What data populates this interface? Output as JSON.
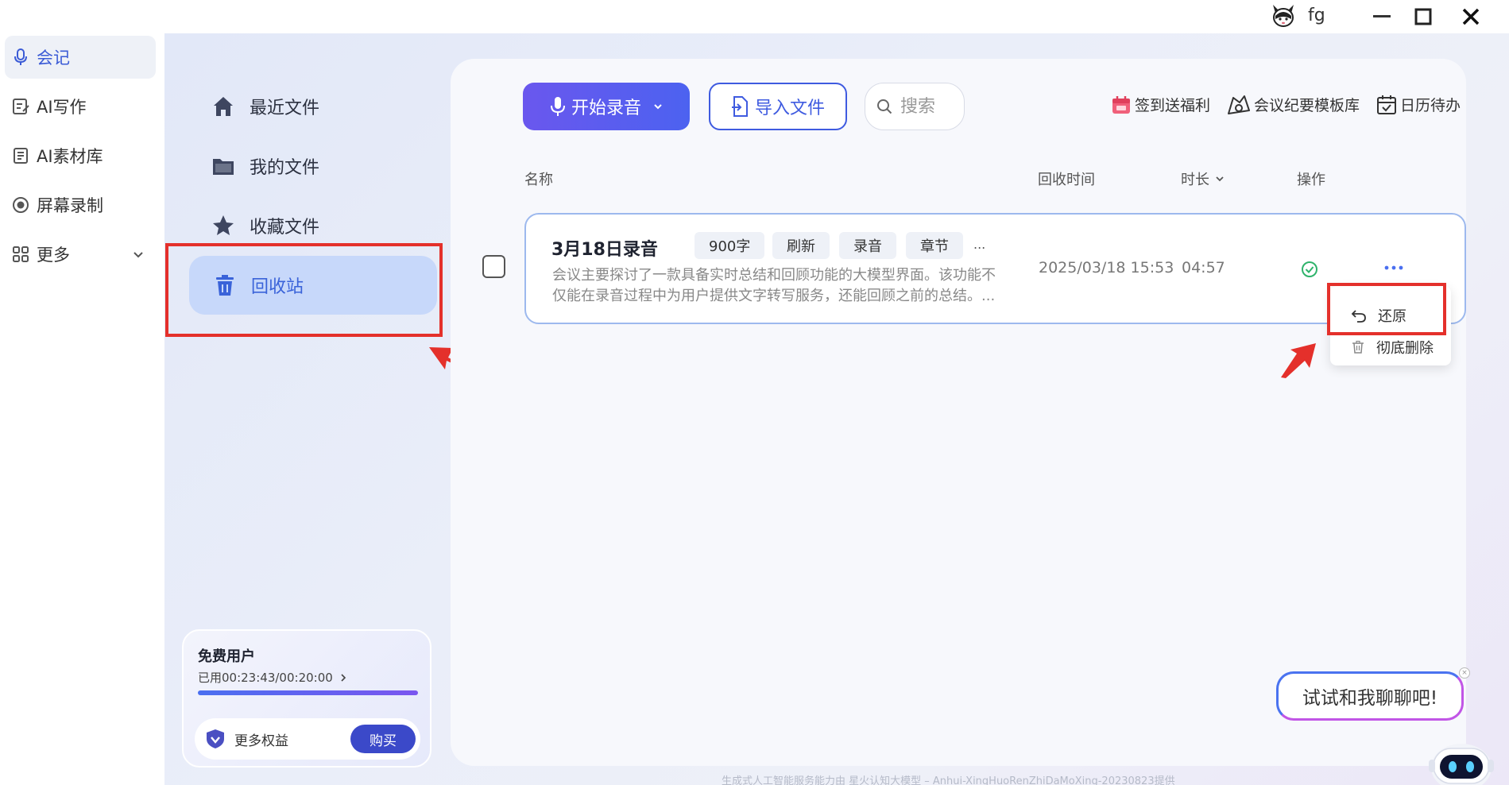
{
  "titlebar": {
    "username": "fg",
    "icons": [
      "avatar-icon",
      "minimize-icon",
      "maximize-icon",
      "close-icon"
    ]
  },
  "leftnav": {
    "items": [
      {
        "label": "会记",
        "icon": "microphone-icon",
        "active": true
      },
      {
        "label": "AI写作",
        "icon": "edit-icon"
      },
      {
        "label": "AI素材库",
        "icon": "document-icon"
      },
      {
        "label": "屏幕录制",
        "icon": "record-icon"
      },
      {
        "label": "更多",
        "icon": "grid-icon"
      }
    ]
  },
  "subnav": {
    "items": [
      {
        "label": "最近文件",
        "icon": "home-icon"
      },
      {
        "label": "我的文件",
        "icon": "folder-icon"
      },
      {
        "label": "收藏文件",
        "icon": "star-icon"
      },
      {
        "label": "回收站",
        "icon": "trash-icon",
        "active": true
      }
    ]
  },
  "user_card": {
    "title": "免费用户",
    "usage": "已用00:23:43/00:20:00",
    "usage_fraction": 1.0,
    "more_label": "更多权益",
    "buy_label": "购买"
  },
  "toolbar": {
    "record_label": "开始录音",
    "import_label": "导入文件",
    "search_placeholder": "搜索",
    "links": [
      {
        "label": "签到送福利",
        "icon": "calendar-gift-icon"
      },
      {
        "label": "会议纪要模板库",
        "icon": "template-icon"
      },
      {
        "label": "日历待办",
        "icon": "calendar-check-icon"
      }
    ]
  },
  "table": {
    "headers": {
      "name": "名称",
      "recycle_time": "回收时间",
      "duration": "时长",
      "action": "操作"
    },
    "rows": [
      {
        "title": "3月18日录音",
        "tags": [
          "900字",
          "刷新",
          "录音",
          "章节"
        ],
        "tags_more": "...",
        "description": "会议主要探讨了一款具备实时总结和回顾功能的大模型界面。该功能不仅能在录音过程中为用户提供文字转写服务，还能回顾之前的总结。...",
        "recycle_time": "2025/03/18 15:53",
        "duration": "04:57",
        "status_color": "#2fb36b"
      }
    ]
  },
  "context_menu": {
    "items": [
      {
        "label": "还原",
        "icon": "undo-icon"
      },
      {
        "label": "彻底删除",
        "icon": "trash-icon"
      }
    ]
  },
  "chat_prompt": "试试和我聊聊吧!",
  "chat_close": "×",
  "footer": "生成式人工智能服务能力由 星火认知大模型 – Anhui-XingHuoRenZhiDaMoXing-20230823提供",
  "colors": {
    "accent": "#3b5bd6",
    "highlight": "#e4302b",
    "active_bg": "#c7d8fa"
  }
}
